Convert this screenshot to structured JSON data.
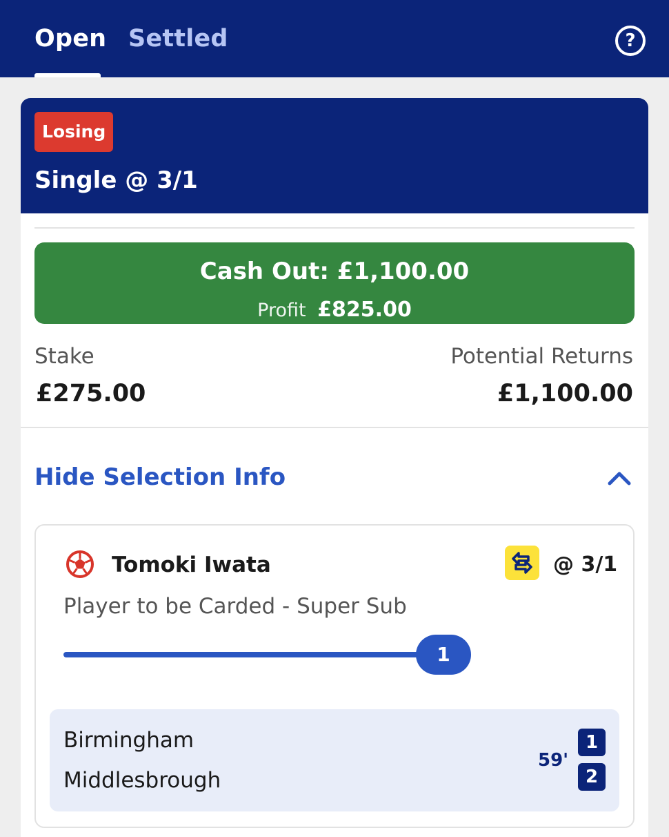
{
  "tabs": {
    "open_label": "Open",
    "settled_label": "Settled",
    "help_glyph": "?"
  },
  "bet": {
    "status": "Losing",
    "title": "Single @ 3/1",
    "cash_out_label": "Cash Out: £1,100.00",
    "profit_label": "Profit",
    "profit_value": "£825.00",
    "stake_label": "Stake",
    "stake_value": "£275.00",
    "returns_label": "Potential Returns",
    "returns_value": "£1,100.00",
    "toggle_label": "Hide Selection Info"
  },
  "selection": {
    "player": "Tomoki Iwata",
    "odds": "@ 3/1",
    "market": "Player to be Carded - Super Sub",
    "progress_count": "1",
    "progress_fraction": 1.0
  },
  "match": {
    "home_team": "Birmingham",
    "away_team": "Middlesbrough",
    "minute": "59'",
    "home_score": "1",
    "away_score": "2"
  },
  "colors": {
    "navy": "#0b2479",
    "losing_red": "#dc3a2f",
    "cashout_green": "#358740",
    "link_blue": "#2a56c2",
    "swap_yellow": "#fce23a"
  },
  "icons": [
    "help-icon",
    "chevron-up-icon",
    "football-icon",
    "swap-icon"
  ]
}
